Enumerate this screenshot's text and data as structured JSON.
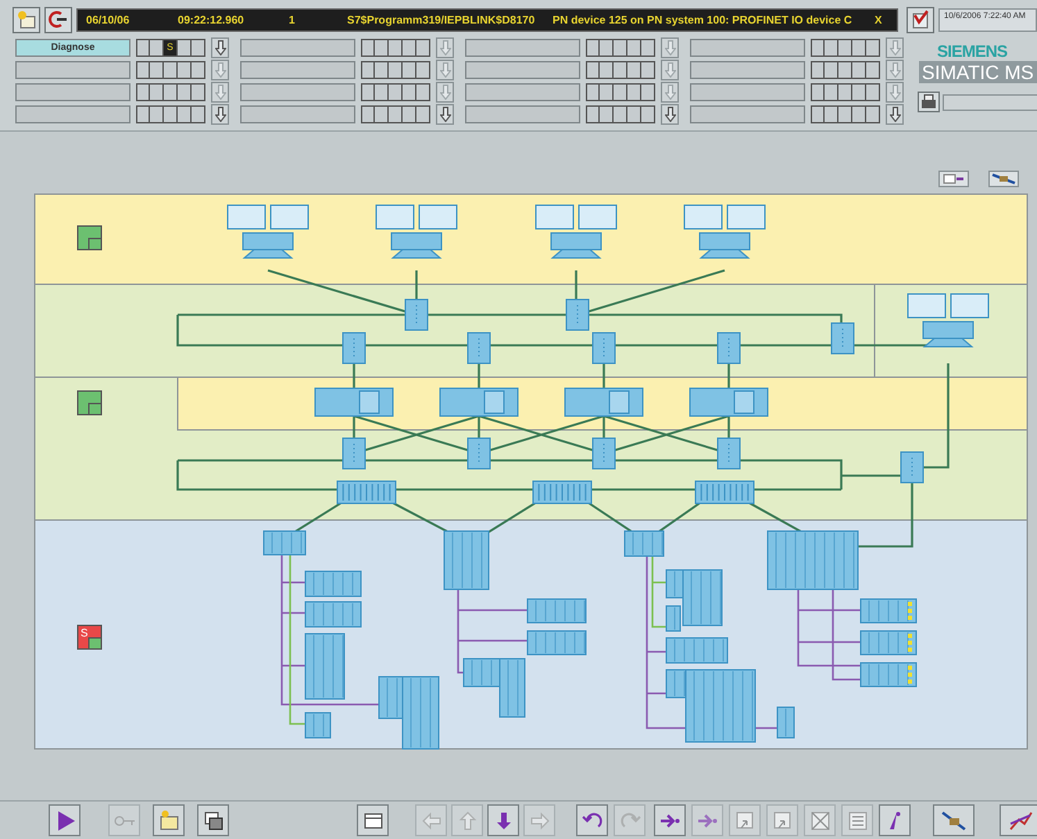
{
  "header": {
    "alarm_line": {
      "date": "06/10/06",
      "time": "09:22:12.960",
      "priority": "1",
      "source": "S7$Programm319/IEPBLINK$D8170",
      "message": "PN device 125 on PN system 100: PROFINET IO device C",
      "acknowledge": "X"
    },
    "areas": [
      {
        "label": "Diagnose",
        "highlighted": true,
        "indicator": "S"
      }
    ],
    "datetime": "10/6/2006 7:22:40 AM",
    "brand": "SIEMENS",
    "product": "SIMATIC MS"
  },
  "diagram": {
    "status_markers": [
      {
        "color": "#6cc070"
      },
      {
        "color": "#6cc070"
      },
      {
        "color": "#e84848",
        "indicator": "S"
      }
    ]
  },
  "toolbar": [
    {
      "kind": "play",
      "disabled": false
    },
    {
      "kind": "key",
      "disabled": true
    },
    {
      "kind": "folder",
      "disabled": false
    },
    {
      "kind": "print",
      "disabled": false
    },
    {
      "kind": "window",
      "disabled": false
    },
    {
      "kind": "left",
      "disabled": true
    },
    {
      "kind": "up",
      "disabled": true
    },
    {
      "kind": "down",
      "disabled": false
    },
    {
      "kind": "right",
      "disabled": true
    },
    {
      "kind": "undo",
      "disabled": false
    },
    {
      "kind": "redo",
      "disabled": true
    },
    {
      "kind": "forward",
      "disabled": false
    },
    {
      "kind": "forward",
      "disabled": true
    },
    {
      "kind": "pick",
      "disabled": true
    },
    {
      "kind": "pick",
      "disabled": true
    },
    {
      "kind": "cross",
      "disabled": true
    },
    {
      "kind": "list",
      "disabled": true
    },
    {
      "kind": "info",
      "disabled": false
    },
    {
      "kind": "tool",
      "disabled": false
    },
    {
      "kind": "curve",
      "disabled": false
    }
  ]
}
